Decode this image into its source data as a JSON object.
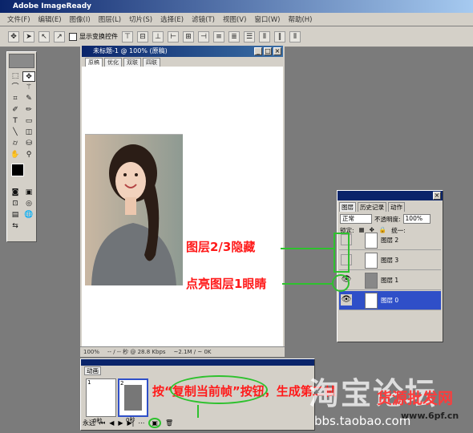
{
  "app": {
    "title": "Adobe ImageReady"
  },
  "menu": [
    "文件(F)",
    "编辑(E)",
    "图像(I)",
    "图层(L)",
    "切片(S)",
    "选择(E)",
    "滤镜(T)",
    "视图(V)",
    "窗口(W)",
    "帮助(H)"
  ],
  "options": {
    "show_transform_label": "显示变换控件"
  },
  "document": {
    "title": "未标题-1 @ 100% (原稿)",
    "tabs": [
      "原稿",
      "优化",
      "双联",
      "四联"
    ],
    "status_zoom": "100%",
    "status_speed": "-- / -- 秒 @ 28.8 Kbps",
    "status_size": "~2.1M / ~ 0K"
  },
  "layers_panel": {
    "tabs": [
      "图层",
      "历史记录",
      "动作"
    ],
    "blend_mode": "正常",
    "opacity_label": "不透明度:",
    "opacity_value": "100%",
    "lock_label": "锁定:",
    "unify_label": "统一:",
    "layers": [
      {
        "name": "图层 2",
        "visible": false,
        "selected": false
      },
      {
        "name": "图层 3",
        "visible": false,
        "selected": false
      },
      {
        "name": "图层 1",
        "visible": true,
        "selected": false
      },
      {
        "name": "图层 0",
        "visible": true,
        "selected": true
      }
    ]
  },
  "animation_panel": {
    "title": "动画",
    "frames": [
      {
        "number": "1",
        "delay": "0秒"
      },
      {
        "number": "2",
        "delay": "0秒"
      }
    ],
    "loop_option": "永远"
  },
  "annotations": {
    "hidden_layers": "图层2/3隐藏",
    "light_eye": "点亮图层1眼睛",
    "copy_frame_prefix": "按",
    "copy_frame_quote": "“复制当前帧”",
    "copy_frame_suffix": "按钮，生成第二帧"
  },
  "watermark": {
    "line1": "淘宝论坛",
    "url": "bbs.taobao.com",
    "site_name": "货源批发网",
    "site_url": "www.6pf.cn"
  },
  "colors": {
    "accent_green": "#2ec12e",
    "annotation_red": "#ff1a1a",
    "selection_blue": "#2f4fc8"
  }
}
